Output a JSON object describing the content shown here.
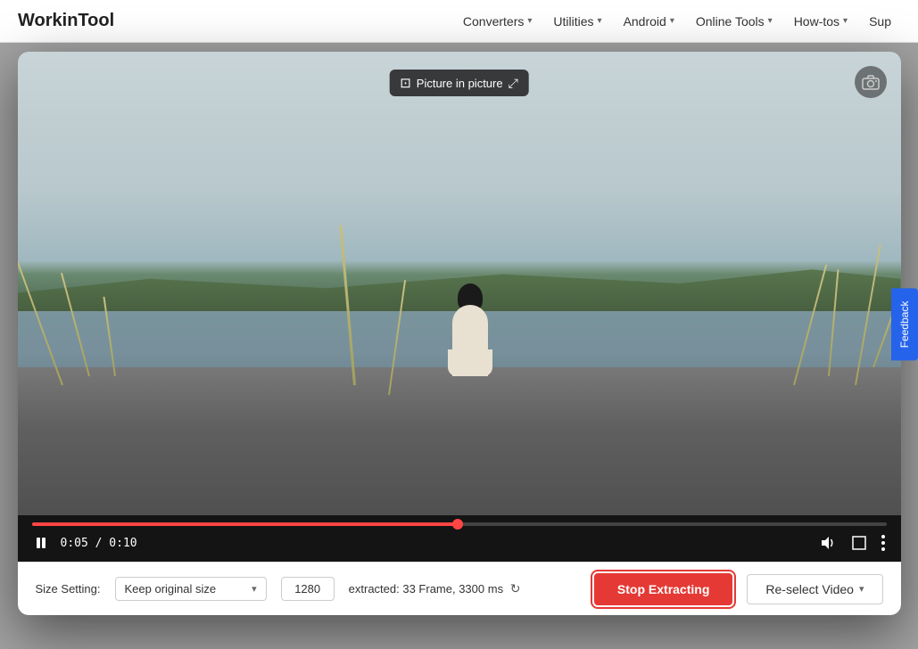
{
  "header": {
    "logo": "WorkinTool",
    "nav": [
      {
        "id": "converters",
        "label": "Converters",
        "has_dropdown": true
      },
      {
        "id": "utilities",
        "label": "Utilities",
        "has_dropdown": true
      },
      {
        "id": "android",
        "label": "Android",
        "has_dropdown": true
      },
      {
        "id": "online-tools",
        "label": "Online Tools",
        "has_dropdown": true
      },
      {
        "id": "how-tos",
        "label": "How-tos",
        "has_dropdown": true
      },
      {
        "id": "sup",
        "label": "Sup",
        "has_dropdown": false
      }
    ]
  },
  "video": {
    "pip_tooltip": "Picture in picture",
    "current_time": "0:05",
    "total_time": "0:10",
    "progress_percent": 50
  },
  "bottom_bar": {
    "size_label": "Size Setting:",
    "size_option": "Keep original size",
    "width_value": "1280",
    "extracted_info": "extracted: 33 Frame, 3300 ms",
    "stop_btn_label": "Stop Extracting",
    "reselect_btn_label": "Re-select Video"
  }
}
